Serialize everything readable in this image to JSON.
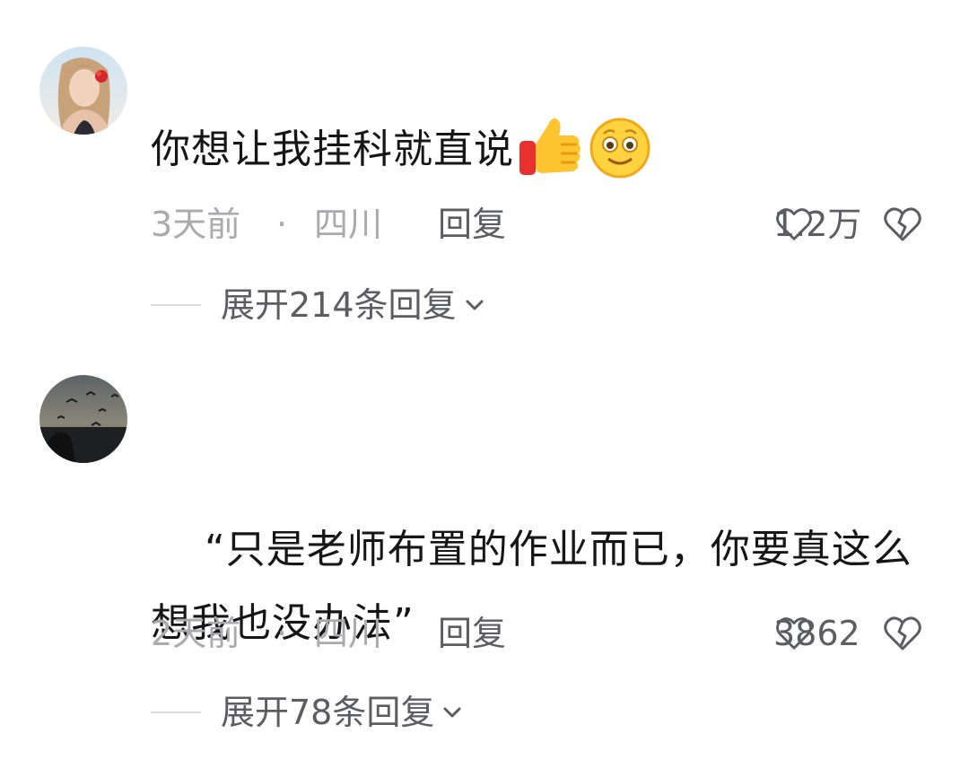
{
  "comments": [
    {
      "avatar": "avatar-girl-flower",
      "text": "你想让我挂科就直说",
      "emojis": [
        "thumbs-up-emoji",
        "smiling-face-emoji"
      ],
      "time": "3天前",
      "separator": "·",
      "location": "四川",
      "reply_label": "回复",
      "like_count": "1.2万",
      "expand_label": "展开214条回复"
    },
    {
      "avatar": "avatar-dusk-birds",
      "text": "“只是老师布置的作业而已，你要真这么想我也没办法”",
      "emojis": [],
      "time": "2天前",
      "separator": "·",
      "location": "四川",
      "reply_label": "回复",
      "like_count": "3862",
      "expand_label": "展开78条回复"
    }
  ],
  "colors": {
    "text_primary": "#161616",
    "text_meta": "#a9a9ae",
    "text_action": "#5c5c63",
    "divider": "#dcdcdf"
  },
  "icons": [
    "heart-outline-icon",
    "broken-heart-icon",
    "chevron-down-icon"
  ]
}
